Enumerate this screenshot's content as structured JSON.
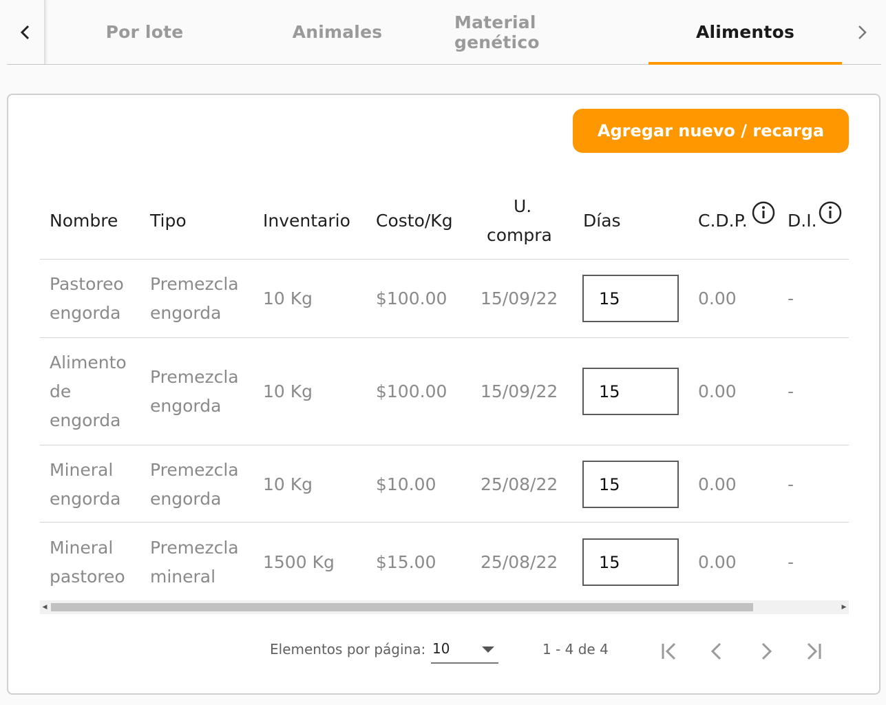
{
  "tabs": [
    {
      "label": "Por lote",
      "active": false
    },
    {
      "label": "Animales",
      "active": false
    },
    {
      "label": "Material genético",
      "active": false
    },
    {
      "label": "Alimentos",
      "active": true
    }
  ],
  "actions": {
    "add_label": "Agregar nuevo / recarga"
  },
  "table": {
    "headers": {
      "nombre": "Nombre",
      "tipo": "Tipo",
      "inventario": "Inventario",
      "costo": "Costo/Kg",
      "ucompra_1": "U.",
      "ucompra_2": "compra",
      "dias": "Días",
      "cdp": "C.D.P.",
      "di": "D.I."
    },
    "rows": [
      {
        "nombre": [
          "Pastoreo",
          "engorda"
        ],
        "tipo": [
          "Premezcla",
          "engorda"
        ],
        "inventario": "10 Kg",
        "costo": "$100.00",
        "ucompra": "15/09/22",
        "dias": "15",
        "cdp": "0.00",
        "di": "-"
      },
      {
        "nombre": [
          "Alimento",
          "de",
          "engorda"
        ],
        "tipo": [
          "Premezcla",
          "engorda"
        ],
        "inventario": "10 Kg",
        "costo": "$100.00",
        "ucompra": "15/09/22",
        "dias": "15",
        "cdp": "0.00",
        "di": "-"
      },
      {
        "nombre": [
          "Mineral",
          "engorda"
        ],
        "tipo": [
          "Premezcla",
          "engorda"
        ],
        "inventario": "10 Kg",
        "costo": "$10.00",
        "ucompra": "25/08/22",
        "dias": "15",
        "cdp": "0.00",
        "di": "-"
      },
      {
        "nombre": [
          "Mineral",
          "pastoreo"
        ],
        "tipo": [
          "Premezcla",
          "mineral"
        ],
        "inventario": "1500 Kg",
        "costo": "$15.00",
        "ucompra": "25/08/22",
        "dias": "15",
        "cdp": "0.00",
        "di": "-"
      }
    ]
  },
  "paginator": {
    "items_label": "Elementos por página:",
    "page_size": "10",
    "range": "1 - 4 de 4"
  },
  "colors": {
    "accent": "#ff9800"
  }
}
